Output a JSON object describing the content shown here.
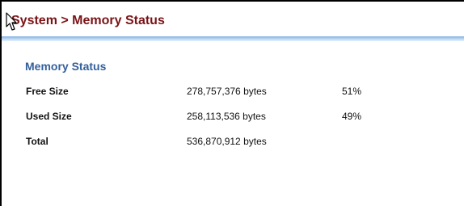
{
  "header": {
    "title": "System > Memory Status"
  },
  "memory_status": {
    "heading": "Memory Status",
    "rows": [
      {
        "label": "Free Size",
        "value": "278,757,376 bytes",
        "percent": "51%"
      },
      {
        "label": "Used Size",
        "value": "258,113,536 bytes",
        "percent": "49%"
      },
      {
        "label": "Total",
        "value": "536,870,912 bytes",
        "percent": ""
      }
    ]
  },
  "icons": {
    "cursor": "mouse-pointer-icon"
  },
  "colors": {
    "title": "#7a1216",
    "section_heading": "#33609c",
    "divider": "#7fb0e3"
  }
}
